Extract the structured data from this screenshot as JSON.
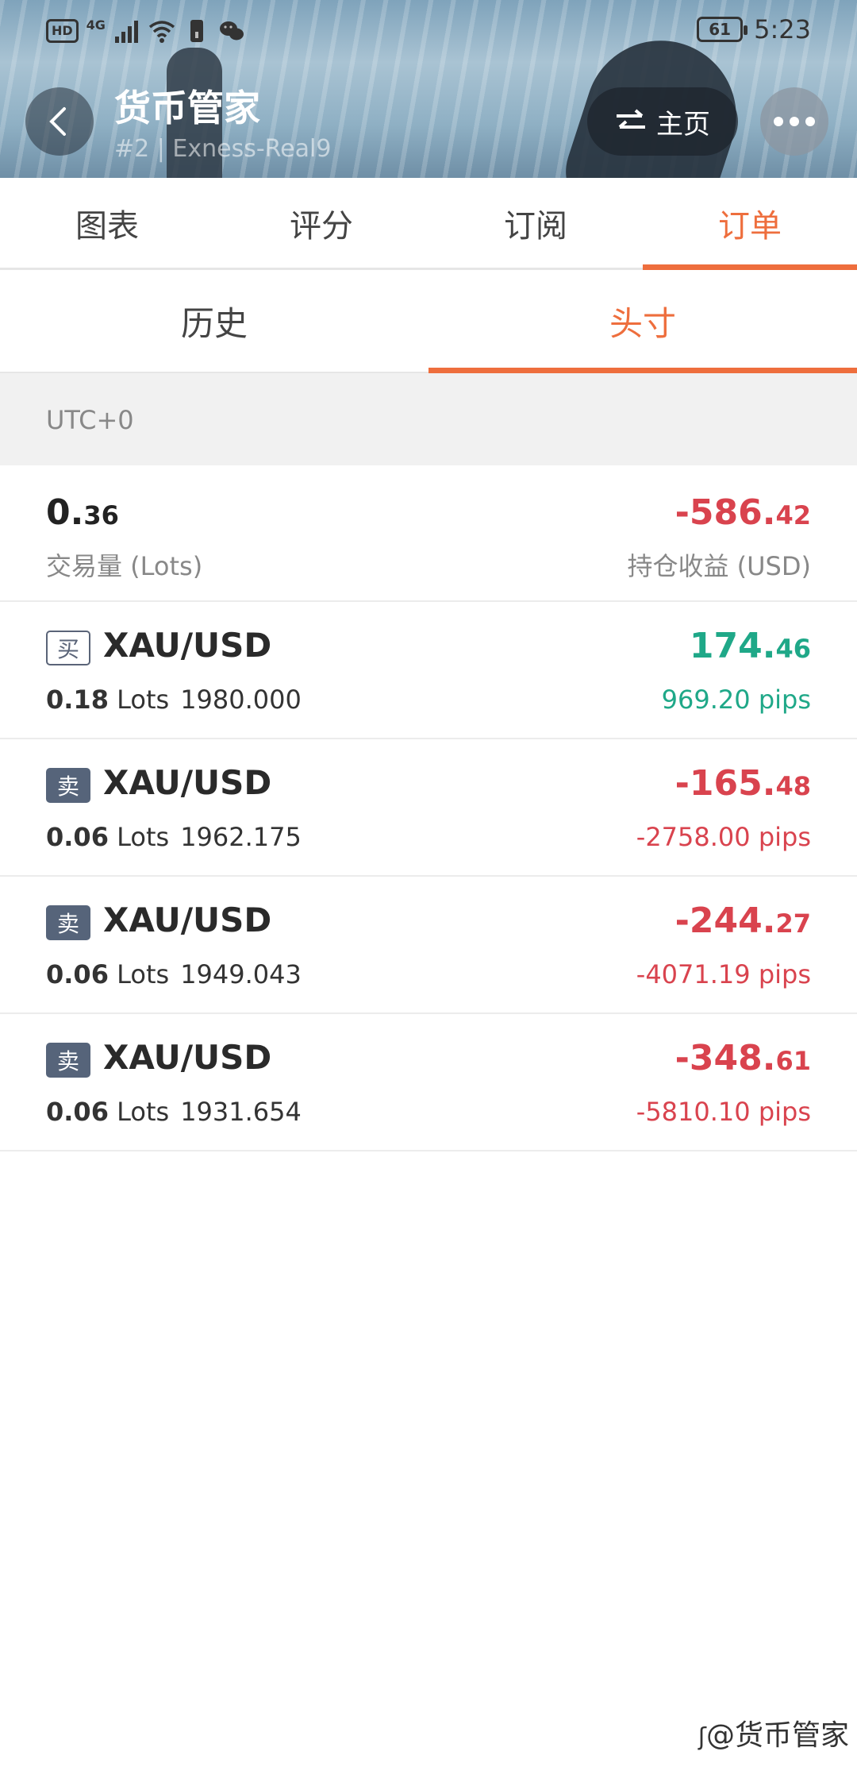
{
  "status_bar": {
    "left_chip": "HD",
    "network": "4G",
    "battery": "61",
    "time": "5:23"
  },
  "header": {
    "title": "货币管家",
    "subtitle": "#2 | Exness-Real9",
    "home_label": "主页"
  },
  "main_tabs": [
    {
      "label": "图表",
      "active": false
    },
    {
      "label": "评分",
      "active": false
    },
    {
      "label": "订阅",
      "active": false
    },
    {
      "label": "订单",
      "active": true
    }
  ],
  "sub_tabs": [
    {
      "label": "历史",
      "active": false
    },
    {
      "label": "头寸",
      "active": true
    }
  ],
  "timezone": "UTC+0",
  "summary": {
    "volume_int": "0.",
    "volume_dec": "36",
    "volume_label": "交易量 (Lots)",
    "pnl_int": "-586.",
    "pnl_dec": "42",
    "pnl_label": "持仓收益 (USD)"
  },
  "positions": [
    {
      "side": "买",
      "symbol": "XAU/USD",
      "lots": "0.18",
      "lots_unit": "Lots",
      "price": "1980.000",
      "pnl_int": "174.",
      "pnl_dec": "46",
      "pips": "969.20 pips"
    },
    {
      "side": "卖",
      "symbol": "XAU/USD",
      "lots": "0.06",
      "lots_unit": "Lots",
      "price": "1962.175",
      "pnl_int": "-165.",
      "pnl_dec": "48",
      "pips": "-2758.00 pips"
    },
    {
      "side": "卖",
      "symbol": "XAU/USD",
      "lots": "0.06",
      "lots_unit": "Lots",
      "price": "1949.043",
      "pnl_int": "-244.",
      "pnl_dec": "27",
      "pips": "-4071.19 pips"
    },
    {
      "side": "卖",
      "symbol": "XAU/USD",
      "lots": "0.06",
      "lots_unit": "Lots",
      "price": "1931.654",
      "pnl_int": "-348.",
      "pnl_dec": "61",
      "pips": "-5810.10 pips"
    }
  ],
  "watermark": "@货币管家",
  "colors": {
    "accent": "#ee6e3d",
    "profit": "#1fa888",
    "loss": "#d9434e"
  }
}
